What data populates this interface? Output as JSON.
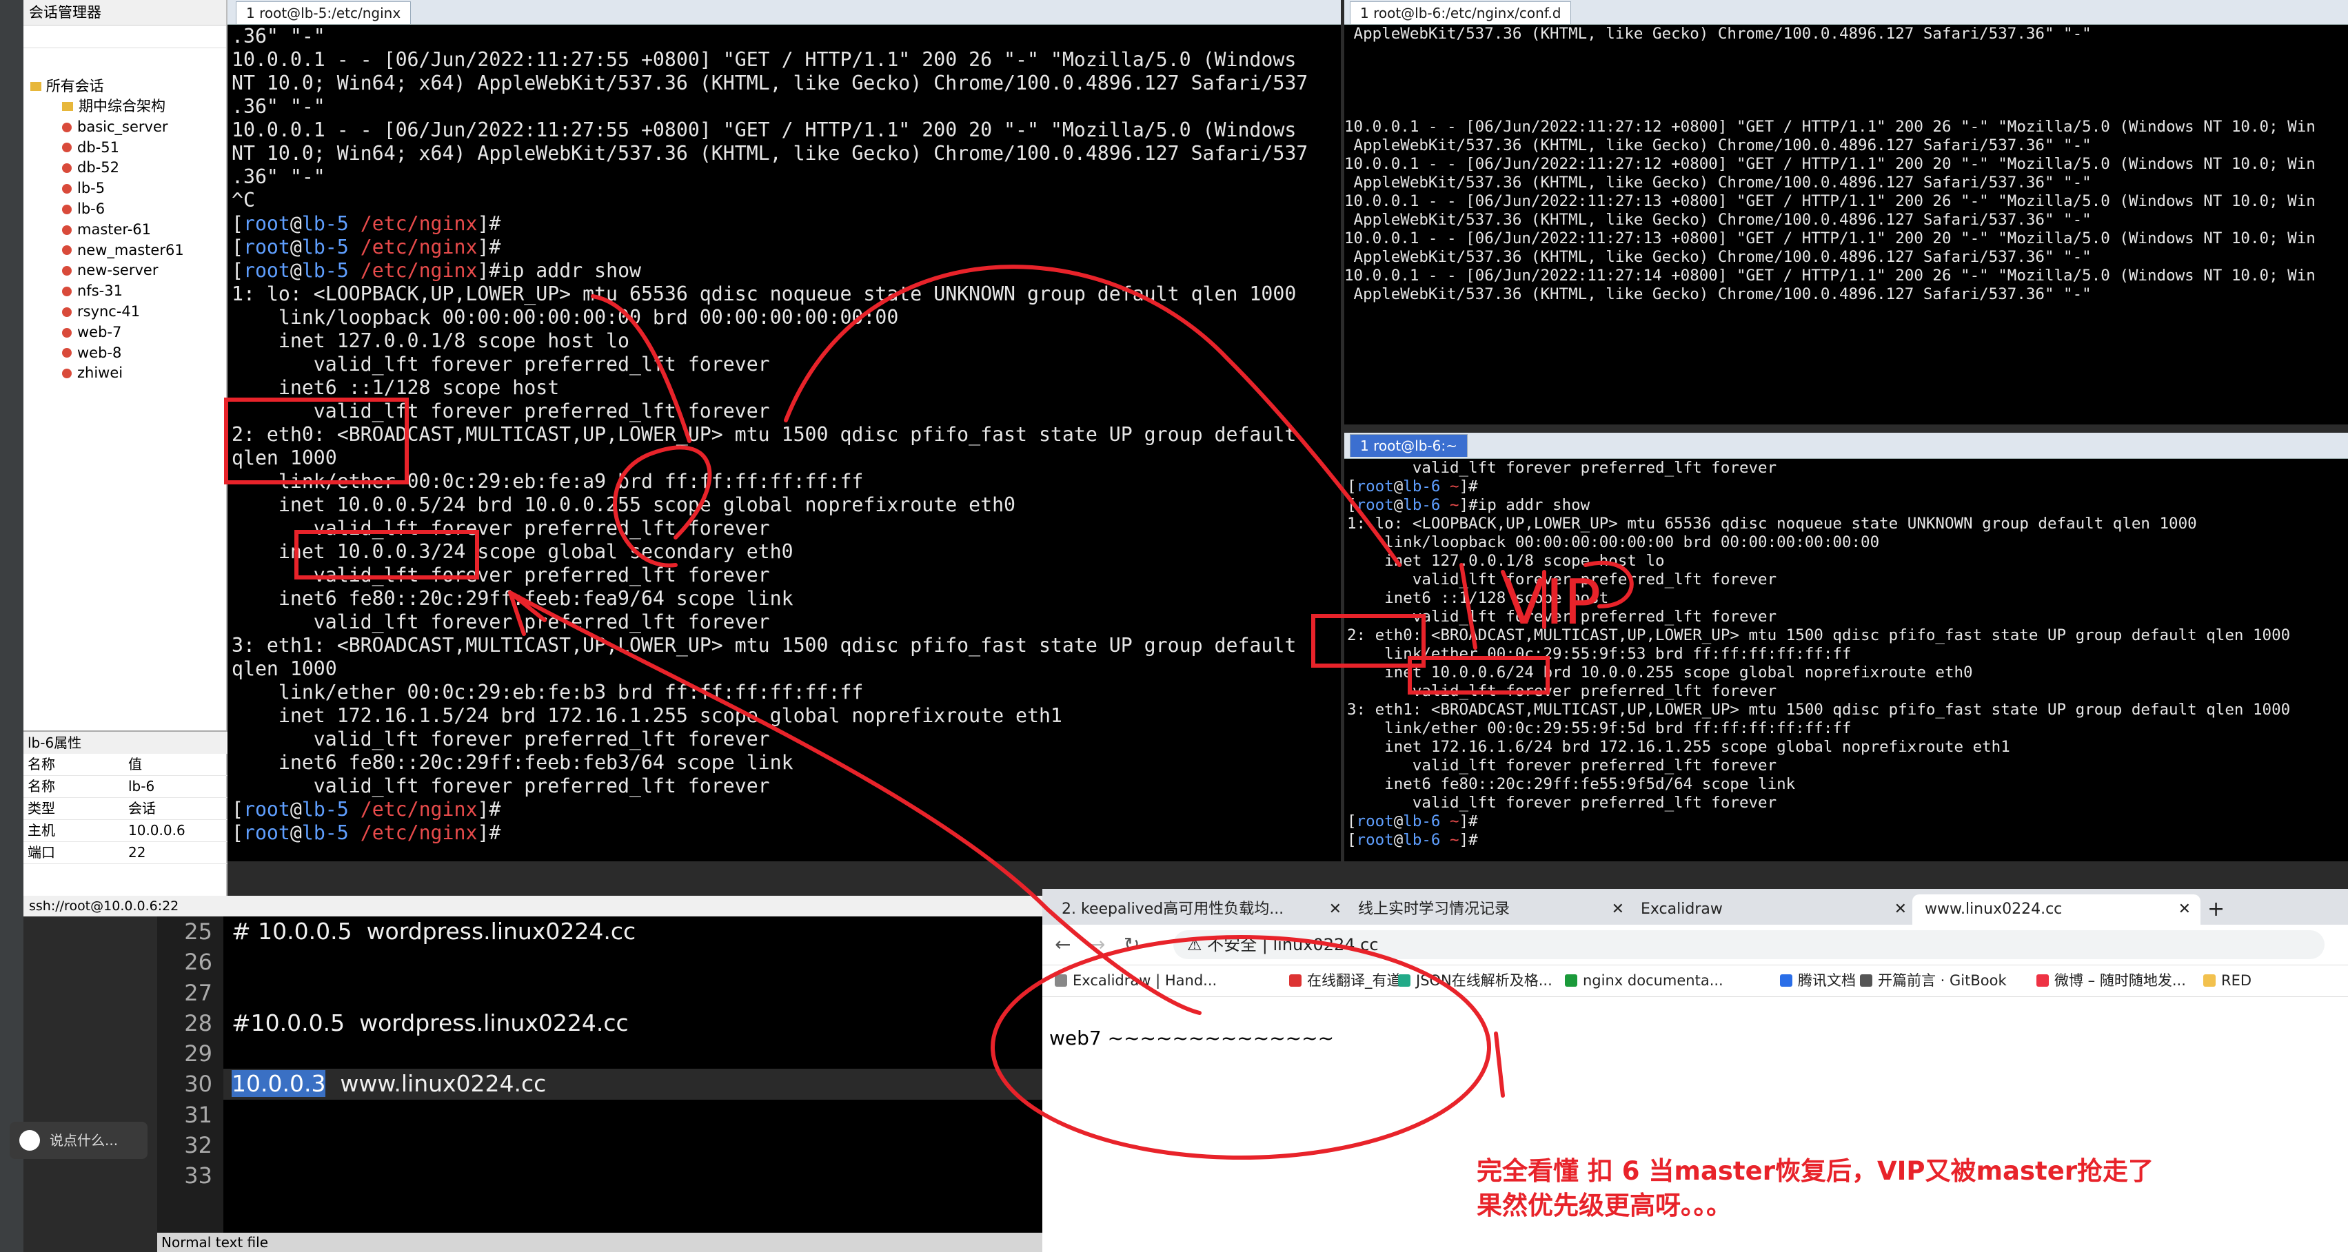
{
  "sidebar": {
    "title": "会话管理器",
    "root": "所有会话",
    "items": [
      "期中综合架构",
      "basic_server",
      "db-51",
      "db-52",
      "lb-5",
      "lb-6",
      "master-61",
      "new_master61",
      "new-server",
      "nfs-31",
      "rsync-41",
      "web-7",
      "web-8",
      "zhiwei"
    ],
    "props_title": "lb-6属性",
    "props_header": [
      "名称",
      "值"
    ],
    "props": [
      [
        "名称",
        "lb-6"
      ],
      [
        "类型",
        "会话"
      ],
      [
        "主机",
        "10.0.0.6"
      ],
      [
        "端口",
        "22"
      ]
    ]
  },
  "ssh_status": "ssh://root@10.0.0.6:22",
  "left_tab": "1 root@lb-5:/etc/nginx",
  "left_terminal": [
    ".36\" \"-\"",
    "10.0.0.1 - - [06/Jun/2022:11:27:55 +0800] \"GET / HTTP/1.1\" 200 26 \"-\" \"Mozilla/5.0 (Windows",
    "NT 10.0; Win64; x64) AppleWebKit/537.36 (KHTML, like Gecko) Chrome/100.0.4896.127 Safari/537",
    ".36\" \"-\"",
    "10.0.0.1 - - [06/Jun/2022:11:27:55 +0800] \"GET / HTTP/1.1\" 200 20 \"-\" \"Mozilla/5.0 (Windows",
    "NT 10.0; Win64; x64) AppleWebKit/537.36 (KHTML, like Gecko) Chrome/100.0.4896.127 Safari/537",
    ".36\" \"-\"",
    "^C",
    "[root@lb-5 /etc/nginx]#",
    "[root@lb-5 /etc/nginx]#",
    "[root@lb-5 /etc/nginx]#ip addr show",
    "1: lo: <LOOPBACK,UP,LOWER_UP> mtu 65536 qdisc noqueue state UNKNOWN group default qlen 1000",
    "    link/loopback 00:00:00:00:00:00 brd 00:00:00:00:00:00",
    "    inet 127.0.0.1/8 scope host lo",
    "       valid_lft forever preferred_lft forever",
    "    inet6 ::1/128 scope host",
    "       valid_lft forever preferred_lft forever",
    "2: eth0: <BROADCAST,MULTICAST,UP,LOWER_UP> mtu 1500 qdisc pfifo_fast state UP group default",
    "qlen 1000",
    "    link/ether 00:0c:29:eb:fe:a9 brd ff:ff:ff:ff:ff:ff",
    "    inet 10.0.0.5/24 brd 10.0.0.255 scope global noprefixroute eth0",
    "       valid_lft forever preferred_lft forever",
    "    inet 10.0.0.3/24 scope global secondary eth0",
    "       valid_lft forever preferred_lft forever",
    "    inet6 fe80::20c:29ff:feeb:fea9/64 scope link",
    "       valid_lft forever preferred_lft forever",
    "3: eth1: <BROADCAST,MULTICAST,UP,LOWER_UP> mtu 1500 qdisc pfifo_fast state UP group default",
    "qlen 1000",
    "    link/ether 00:0c:29:eb:fe:b3 brd ff:ff:ff:ff:ff:ff",
    "    inet 172.16.1.5/24 brd 172.16.1.255 scope global noprefixroute eth1",
    "       valid_lft forever preferred_lft forever",
    "    inet6 fe80::20c:29ff:feeb:feb3/64 scope link",
    "       valid_lft forever preferred_lft forever",
    "[root@lb-5 /etc/nginx]#",
    "[root@lb-5 /etc/nginx]#"
  ],
  "right_top_tab": "1 root@lb-6:/etc/nginx/conf.d",
  "right_top_terminal": [
    " AppleWebKit/537.36 (KHTML, like Gecko) Chrome/100.0.4896.127 Safari/537.36\" \"-\"",
    "",
    "",
    "",
    "",
    "10.0.0.1 - - [06/Jun/2022:11:27:12 +0800] \"GET / HTTP/1.1\" 200 26 \"-\" \"Mozilla/5.0 (Windows NT 10.0; Win",
    " AppleWebKit/537.36 (KHTML, like Gecko) Chrome/100.0.4896.127 Safari/537.36\" \"-\"",
    "10.0.0.1 - - [06/Jun/2022:11:27:12 +0800] \"GET / HTTP/1.1\" 200 20 \"-\" \"Mozilla/5.0 (Windows NT 10.0; Win",
    " AppleWebKit/537.36 (KHTML, like Gecko) Chrome/100.0.4896.127 Safari/537.36\" \"-\"",
    "10.0.0.1 - - [06/Jun/2022:11:27:13 +0800] \"GET / HTTP/1.1\" 200 26 \"-\" \"Mozilla/5.0 (Windows NT 10.0; Win",
    " AppleWebKit/537.36 (KHTML, like Gecko) Chrome/100.0.4896.127 Safari/537.36\" \"-\"",
    "10.0.0.1 - - [06/Jun/2022:11:27:13 +0800] \"GET / HTTP/1.1\" 200 20 \"-\" \"Mozilla/5.0 (Windows NT 10.0; Win",
    " AppleWebKit/537.36 (KHTML, like Gecko) Chrome/100.0.4896.127 Safari/537.36\" \"-\"",
    "10.0.0.1 - - [06/Jun/2022:11:27:14 +0800] \"GET / HTTP/1.1\" 200 26 \"-\" \"Mozilla/5.0 (Windows NT 10.0; Win",
    " AppleWebKit/537.36 (KHTML, like Gecko) Chrome/100.0.4896.127 Safari/537.36\" \"-\""
  ],
  "right_bottom_tab": "1 root@lb-6:~",
  "right_bottom_terminal": [
    "       valid_lft forever preferred_lft forever",
    "[root@lb-6 ~]#",
    "[root@lb-6 ~]#ip addr show",
    "1: lo: <LOOPBACK,UP,LOWER_UP> mtu 65536 qdisc noqueue state UNKNOWN group default qlen 1000",
    "    link/loopback 00:00:00:00:00:00 brd 00:00:00:00:00:00",
    "    inet 127.0.0.1/8 scope host lo",
    "       valid_lft forever preferred_lft forever",
    "    inet6 ::1/128 scope host",
    "       valid_lft forever preferred_lft forever",
    "2: eth0: <BROADCAST,MULTICAST,UP,LOWER_UP> mtu 1500 qdisc pfifo_fast state UP group default qlen 1000",
    "    link/ether 00:0c:29:55:9f:53 brd ff:ff:ff:ff:ff:ff",
    "    inet 10.0.0.6/24 brd 10.0.0.255 scope global noprefixroute eth0",
    "       valid_lft forever preferred_lft forever",
    "3: eth1: <BROADCAST,MULTICAST,UP,LOWER_UP> mtu 1500 qdisc pfifo_fast state UP group default qlen 1000",
    "    link/ether 00:0c:29:55:9f:5d brd ff:ff:ff:ff:ff:ff",
    "    inet 172.16.1.6/24 brd 172.16.1.255 scope global noprefixroute eth1",
    "       valid_lft forever preferred_lft forever",
    "    inet6 fe80::20c:29ff:fe55:9f5d/64 scope link",
    "       valid_lft forever preferred_lft forever",
    "[root@lb-6 ~]#",
    "[root@lb-6 ~]#"
  ],
  "editor": {
    "line_numbers": [
      "25",
      "26",
      "27",
      "28",
      "29",
      "30",
      "31",
      "32",
      "33"
    ],
    "lines": [
      "# 10.0.0.5  wordpress.linux0224.cc",
      "",
      "",
      "#10.0.0.5  wordpress.linux0224.cc",
      "",
      "10.0.0.3  www.linux0224.cc",
      "",
      "",
      ""
    ],
    "selected_text": "10.0.0.3",
    "status": "Normal text file"
  },
  "chat_placeholder": "说点什么...",
  "browser": {
    "tabs": [
      "2. keepalived高可用性负载均...",
      "线上实时学习情况记录",
      "Excalidraw",
      "www.linux0224.cc"
    ],
    "insecure_label": "不安全",
    "url": "linux0224.cc",
    "bookmarks": [
      "Excalidraw | Hand...",
      "在线翻译_有道",
      "JSON在线解析及格...",
      "nginx documenta...",
      "腾讯文档",
      "开篇前言 · GitBook",
      "微博 – 随时随地发...",
      "RED"
    ],
    "page_text": "web7 ~~~~~~~~~~~~~~",
    "note_line1": "完全看懂 扣  6  当master恢复后，VIP又被master抢走了",
    "note_line2": "果然优先级更高呀。。。"
  },
  "annotation_text": "VIP",
  "colors": {
    "annotation": "#e8232a",
    "prompt_user": "#5f9fff",
    "prompt_host": "#e84b4b"
  }
}
